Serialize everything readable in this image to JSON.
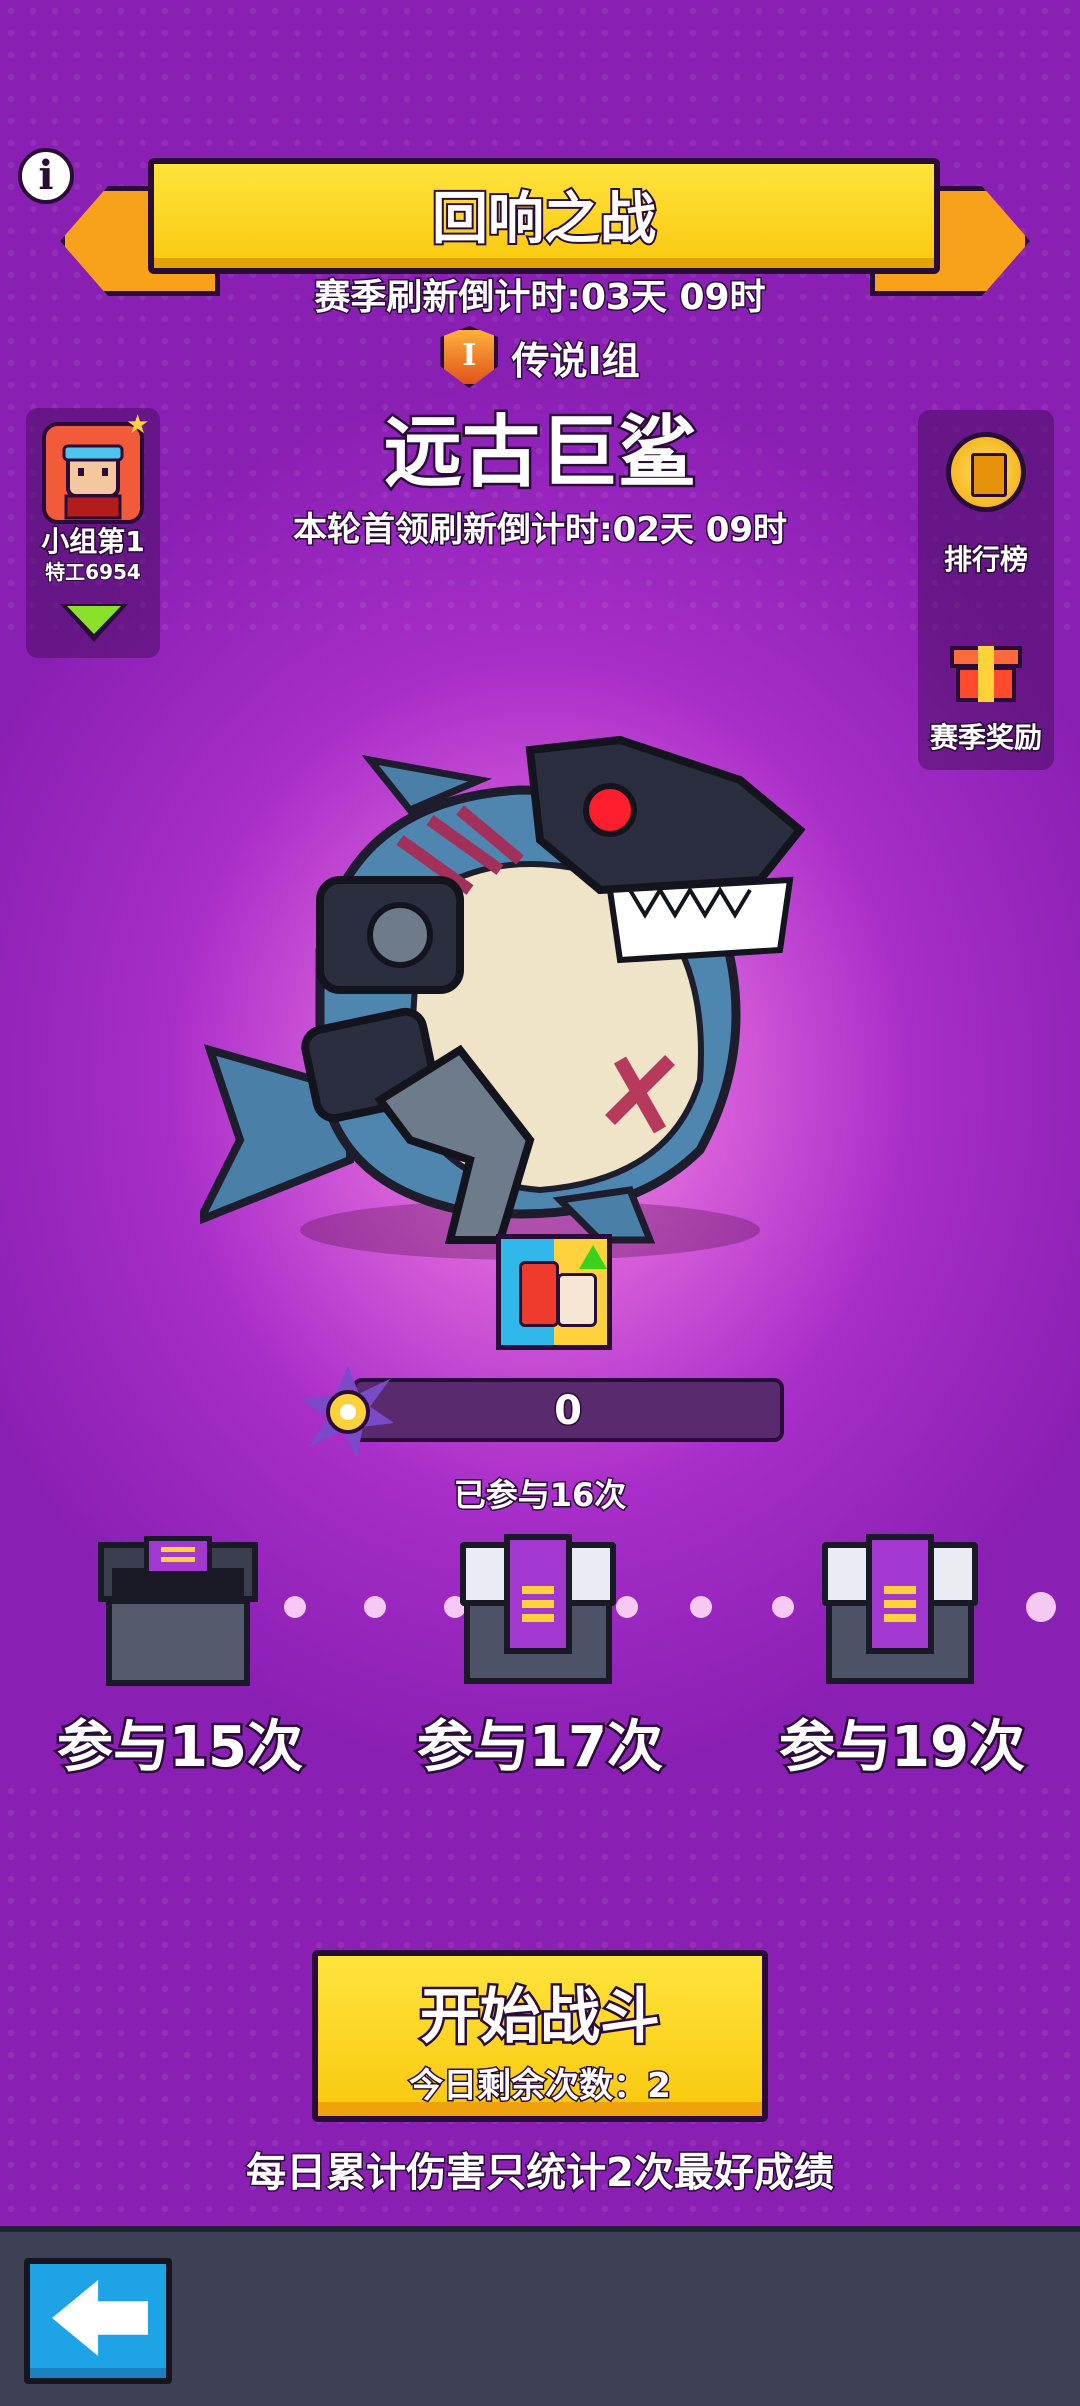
{
  "header": {
    "title": "回响之战",
    "season_countdown": "赛季刷新倒计时:03天 09时",
    "league_badge": "I",
    "league": "传说I组",
    "info_icon": "info-icon"
  },
  "boss": {
    "name": "远古巨鲨",
    "countdown": "本轮首领刷新倒计时:02天 09时"
  },
  "rank_card": {
    "rank": "小组第1",
    "player": "特工6954"
  },
  "right_menu": {
    "leaderboard": "排行榜",
    "season_rewards": "赛季奖励"
  },
  "damage": {
    "value": "0",
    "participation": "已参与16次"
  },
  "milestones": [
    {
      "label": "参与15次",
      "state": "opened"
    },
    {
      "label": "参与17次",
      "state": "locked"
    },
    {
      "label": "参与19次",
      "state": "locked"
    }
  ],
  "start_button": {
    "label": "开始战斗",
    "remaining": "今日剩余次数：2"
  },
  "footer_note": "每日累计伤害只统计2次最好成绩",
  "colors": {
    "accent_yellow": "#f9c80e",
    "purple": "#a82ec9",
    "bottom_bar": "#3e4156",
    "back_button": "#1ea3e6"
  }
}
